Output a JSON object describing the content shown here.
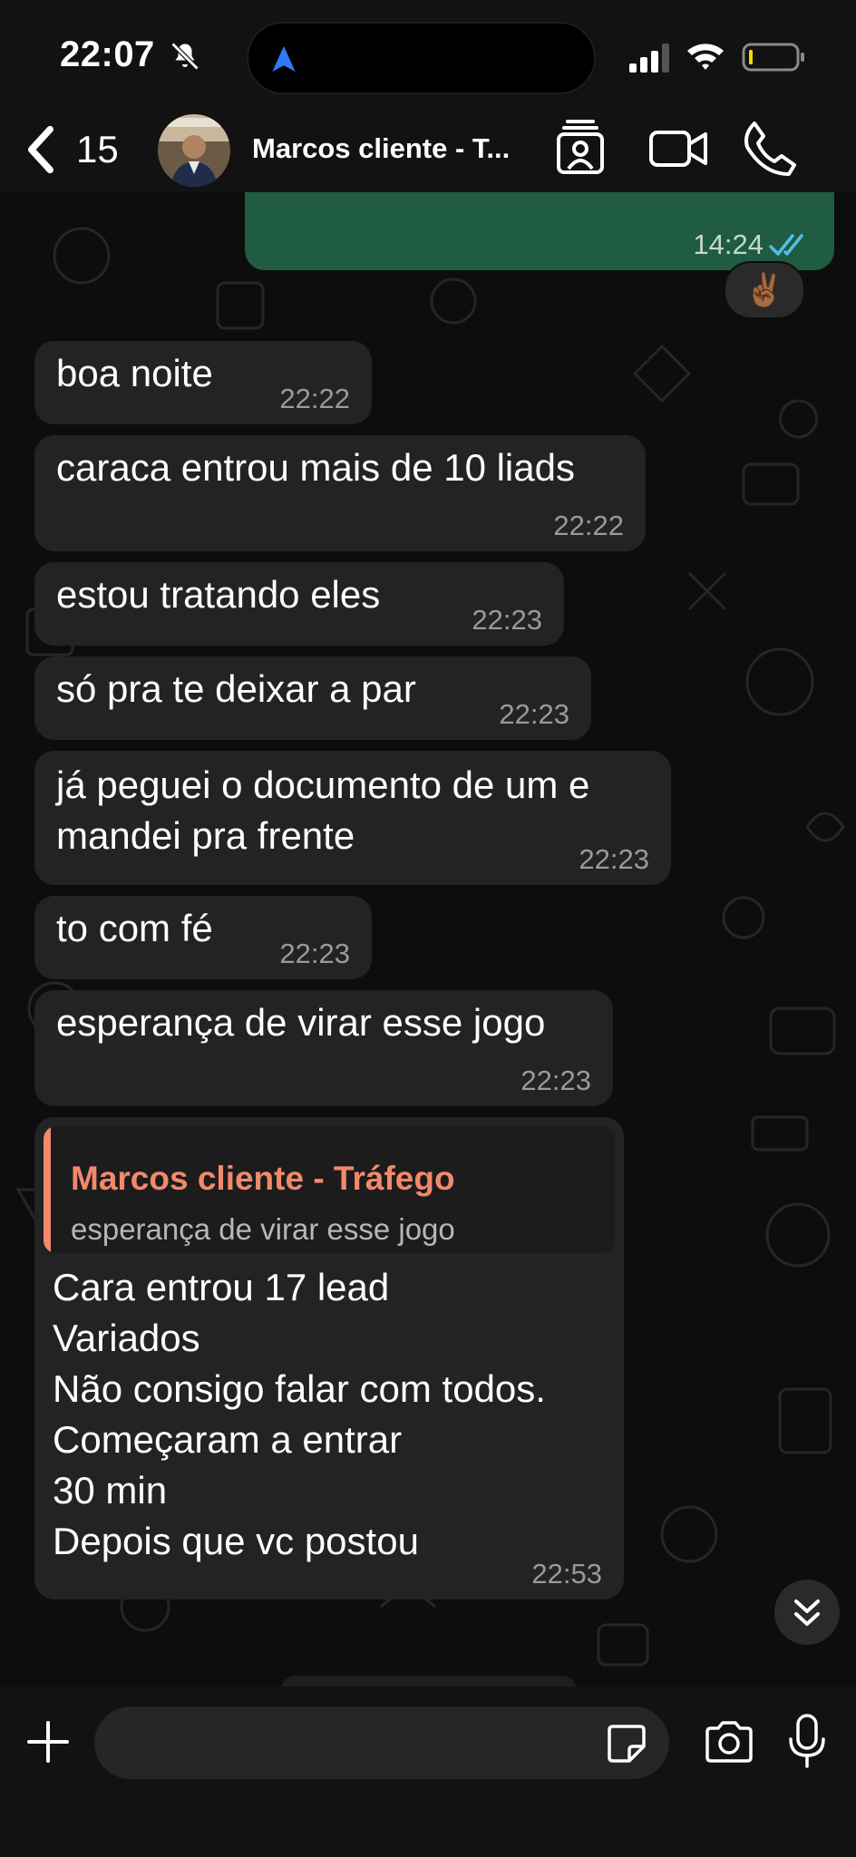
{
  "status_bar": {
    "time": "22:07"
  },
  "header": {
    "back_count": "15",
    "contact_name": "Marcos cliente - T..."
  },
  "messages": [
    {
      "direction": "out",
      "text": "",
      "time": "14:24",
      "reaction": "✌🏾"
    },
    {
      "direction": "in",
      "text": "boa noite",
      "time": "22:22"
    },
    {
      "direction": "in",
      "text": "caraca entrou mais de 10 liads",
      "time": "22:22"
    },
    {
      "direction": "in",
      "text": "estou tratando eles",
      "time": "22:23"
    },
    {
      "direction": "in",
      "text": "só pra te deixar a par",
      "time": "22:23"
    },
    {
      "direction": "in",
      "lines": [
        "já peguei o documento de um e",
        "mandei pra frente"
      ],
      "time": "22:23"
    },
    {
      "direction": "in",
      "text": "to com fé",
      "time": "22:23"
    },
    {
      "direction": "in",
      "text": "esperança de virar esse jogo",
      "time": "22:23"
    },
    {
      "direction": "in",
      "quote": {
        "author": "Marcos cliente - Tráfego",
        "text": "esperança de virar esse jogo"
      },
      "lines": [
        "Cara entrou 17 lead",
        "Variados",
        "Não consigo falar com todos.",
        "Começaram a entrar",
        "30 min",
        "Depois que vc postou"
      ],
      "time": "22:53"
    }
  ],
  "composer": {
    "placeholder": ""
  },
  "colors": {
    "incoming_bubble": "#222325",
    "outgoing_bubble": "#1f5c42",
    "quote_accent": "#f2896b",
    "read_ticks": "#53bdeb"
  }
}
